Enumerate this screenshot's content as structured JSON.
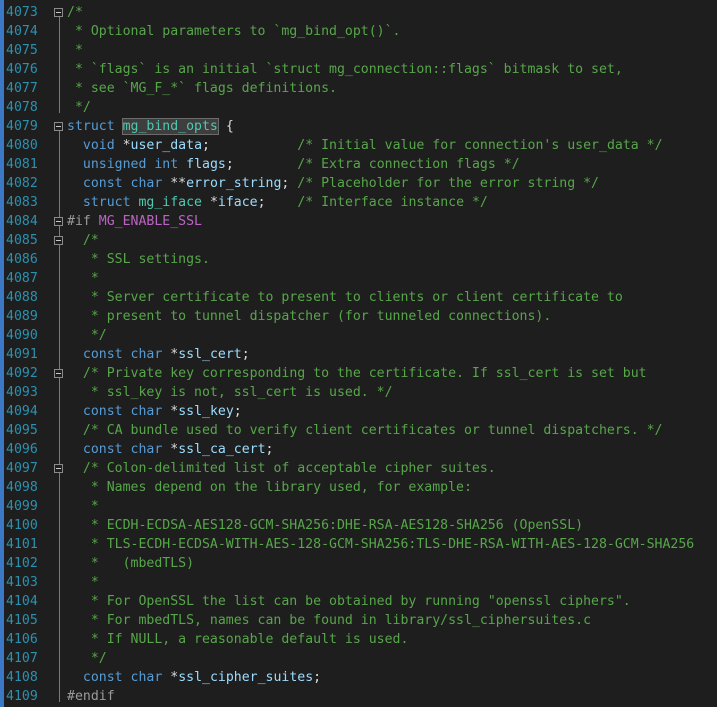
{
  "editor": {
    "lines": [
      {
        "num": "4073",
        "fold": true,
        "segs": [
          {
            "c": "comment",
            "t": "/*"
          }
        ]
      },
      {
        "num": "4074",
        "segs": [
          {
            "c": "comment",
            "t": " * Optional parameters to `mg_bind_opt()`."
          }
        ]
      },
      {
        "num": "4075",
        "segs": [
          {
            "c": "comment",
            "t": " *"
          }
        ]
      },
      {
        "num": "4076",
        "segs": [
          {
            "c": "comment",
            "t": " * `flags` is an initial `struct mg_connection::flags` bitmask to set,"
          }
        ]
      },
      {
        "num": "4077",
        "segs": [
          {
            "c": "comment",
            "t": " * see `MG_F_*` flags definitions."
          }
        ]
      },
      {
        "num": "4078",
        "segs": [
          {
            "c": "comment",
            "t": " */"
          }
        ]
      },
      {
        "num": "4079",
        "fold": true,
        "segs": [
          {
            "c": "kw",
            "t": "struct"
          },
          {
            "c": "plain",
            "t": " "
          },
          {
            "c": "type hl",
            "t": "mg_bind_opts"
          },
          {
            "c": "plain",
            "t": " {"
          }
        ]
      },
      {
        "num": "4080",
        "segs": [
          {
            "c": "plain",
            "t": "  "
          },
          {
            "c": "kw",
            "t": "void"
          },
          {
            "c": "plain",
            "t": " *"
          },
          {
            "c": "param",
            "t": "user_data"
          },
          {
            "c": "plain",
            "t": ";           "
          },
          {
            "c": "comment",
            "t": "/* Initial value for connection's user_data */"
          }
        ]
      },
      {
        "num": "4081",
        "segs": [
          {
            "c": "plain",
            "t": "  "
          },
          {
            "c": "kw",
            "t": "unsigned int"
          },
          {
            "c": "plain",
            "t": " "
          },
          {
            "c": "param",
            "t": "flags"
          },
          {
            "c": "plain",
            "t": ";        "
          },
          {
            "c": "comment",
            "t": "/* Extra connection flags */"
          }
        ]
      },
      {
        "num": "4082",
        "segs": [
          {
            "c": "plain",
            "t": "  "
          },
          {
            "c": "kw",
            "t": "const char"
          },
          {
            "c": "plain",
            "t": " **"
          },
          {
            "c": "param",
            "t": "error_string"
          },
          {
            "c": "plain",
            "t": "; "
          },
          {
            "c": "comment",
            "t": "/* Placeholder for the error string */"
          }
        ]
      },
      {
        "num": "4083",
        "segs": [
          {
            "c": "plain",
            "t": "  "
          },
          {
            "c": "kw",
            "t": "struct"
          },
          {
            "c": "plain",
            "t": " "
          },
          {
            "c": "type",
            "t": "mg_iface"
          },
          {
            "c": "plain",
            "t": " *"
          },
          {
            "c": "param",
            "t": "iface"
          },
          {
            "c": "plain",
            "t": ";    "
          },
          {
            "c": "comment",
            "t": "/* Interface instance */"
          }
        ]
      },
      {
        "num": "4084",
        "fold": true,
        "segs": [
          {
            "c": "pre",
            "t": "#if "
          },
          {
            "c": "macro",
            "t": "MG_ENABLE_SSL"
          }
        ]
      },
      {
        "num": "4085",
        "fold": true,
        "segs": [
          {
            "c": "plain",
            "t": "  "
          },
          {
            "c": "comment",
            "t": "/*"
          }
        ]
      },
      {
        "num": "4086",
        "segs": [
          {
            "c": "comment",
            "t": "   * SSL settings."
          }
        ]
      },
      {
        "num": "4087",
        "segs": [
          {
            "c": "comment",
            "t": "   *"
          }
        ]
      },
      {
        "num": "4088",
        "segs": [
          {
            "c": "comment",
            "t": "   * Server certificate to present to clients or client certificate to"
          }
        ]
      },
      {
        "num": "4089",
        "segs": [
          {
            "c": "comment",
            "t": "   * present to tunnel dispatcher (for tunneled connections)."
          }
        ]
      },
      {
        "num": "4090",
        "segs": [
          {
            "c": "comment",
            "t": "   */"
          }
        ]
      },
      {
        "num": "4091",
        "segs": [
          {
            "c": "plain",
            "t": "  "
          },
          {
            "c": "kw",
            "t": "const char"
          },
          {
            "c": "plain",
            "t": " *"
          },
          {
            "c": "param",
            "t": "ssl_cert"
          },
          {
            "c": "plain",
            "t": ";"
          }
        ]
      },
      {
        "num": "4092",
        "fold": true,
        "segs": [
          {
            "c": "plain",
            "t": "  "
          },
          {
            "c": "comment",
            "t": "/* Private key corresponding to the certificate. If ssl_cert is set but"
          }
        ]
      },
      {
        "num": "4093",
        "segs": [
          {
            "c": "comment",
            "t": "   * ssl_key is not, ssl_cert is used. */"
          }
        ]
      },
      {
        "num": "4094",
        "segs": [
          {
            "c": "plain",
            "t": "  "
          },
          {
            "c": "kw",
            "t": "const char"
          },
          {
            "c": "plain",
            "t": " *"
          },
          {
            "c": "param",
            "t": "ssl_key"
          },
          {
            "c": "plain",
            "t": ";"
          }
        ]
      },
      {
        "num": "4095",
        "segs": [
          {
            "c": "plain",
            "t": "  "
          },
          {
            "c": "comment",
            "t": "/* CA bundle used to verify client certificates or tunnel dispatchers. */"
          }
        ]
      },
      {
        "num": "4096",
        "segs": [
          {
            "c": "plain",
            "t": "  "
          },
          {
            "c": "kw",
            "t": "const char"
          },
          {
            "c": "plain",
            "t": " *"
          },
          {
            "c": "param",
            "t": "ssl_ca_cert"
          },
          {
            "c": "plain",
            "t": ";"
          }
        ]
      },
      {
        "num": "4097",
        "fold": true,
        "segs": [
          {
            "c": "plain",
            "t": "  "
          },
          {
            "c": "comment",
            "t": "/* Colon-delimited list of acceptable cipher suites."
          }
        ]
      },
      {
        "num": "4098",
        "segs": [
          {
            "c": "comment",
            "t": "   * Names depend on the library used, for example:"
          }
        ]
      },
      {
        "num": "4099",
        "segs": [
          {
            "c": "comment",
            "t": "   *"
          }
        ]
      },
      {
        "num": "4100",
        "segs": [
          {
            "c": "comment",
            "t": "   * ECDH-ECDSA-AES128-GCM-SHA256:DHE-RSA-AES128-SHA256 (OpenSSL)"
          }
        ]
      },
      {
        "num": "4101",
        "segs": [
          {
            "c": "comment",
            "t": "   * TLS-ECDH-ECDSA-WITH-AES-128-GCM-SHA256:TLS-DHE-RSA-WITH-AES-128-GCM-SHA256"
          }
        ]
      },
      {
        "num": "4102",
        "segs": [
          {
            "c": "comment",
            "t": "   *   (mbedTLS)"
          }
        ]
      },
      {
        "num": "4103",
        "segs": [
          {
            "c": "comment",
            "t": "   *"
          }
        ]
      },
      {
        "num": "4104",
        "segs": [
          {
            "c": "comment",
            "t": "   * For OpenSSL the list can be obtained by running \"openssl ciphers\"."
          }
        ]
      },
      {
        "num": "4105",
        "segs": [
          {
            "c": "comment",
            "t": "   * For mbedTLS, names can be found in library/ssl_ciphersuites.c"
          }
        ]
      },
      {
        "num": "4106",
        "segs": [
          {
            "c": "comment",
            "t": "   * If NULL, a reasonable default is used."
          }
        ]
      },
      {
        "num": "4107",
        "segs": [
          {
            "c": "comment",
            "t": "   */"
          }
        ]
      },
      {
        "num": "4108",
        "segs": [
          {
            "c": "plain",
            "t": "  "
          },
          {
            "c": "kw",
            "t": "const char"
          },
          {
            "c": "plain",
            "t": " *"
          },
          {
            "c": "param",
            "t": "ssl_cipher_suites"
          },
          {
            "c": "plain",
            "t": ";"
          }
        ]
      },
      {
        "num": "4109",
        "segs": [
          {
            "c": "pre",
            "t": "#endif"
          }
        ]
      }
    ]
  }
}
